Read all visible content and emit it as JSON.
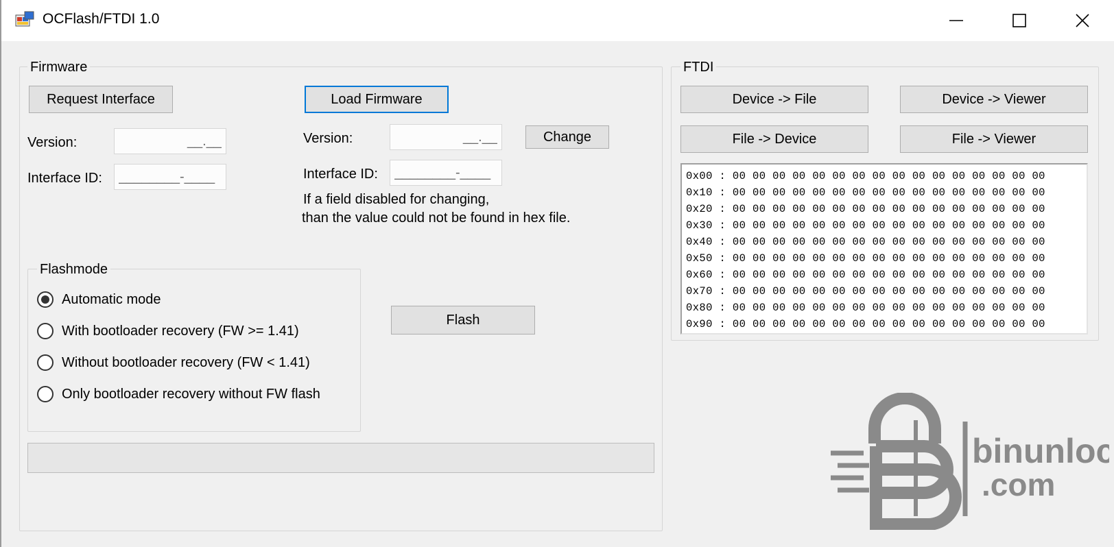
{
  "window": {
    "title": "OCFlash/FTDI 1.0"
  },
  "firmware": {
    "group_label": "Firmware",
    "request_interface_label": "Request Interface",
    "load_firmware_label": "Load Firmware",
    "version_label": "Version:",
    "interface_id_label": "Interface ID:",
    "version_value": "__.__",
    "interface_id_value": "________-____",
    "fw_version_label": "Version:",
    "fw_version_value": "__.__",
    "fw_interface_id_label": "Interface ID:",
    "fw_interface_id_value": "________-____",
    "change_label": "Change",
    "note_line1": "If a field disabled for changing,",
    "note_line2": "than the value could not be found in hex file."
  },
  "flashmode": {
    "group_label": "Flashmode",
    "options": [
      {
        "label": "Automatic mode",
        "checked": true
      },
      {
        "label": "With bootloader recovery (FW >= 1.41)",
        "checked": false
      },
      {
        "label": "Without bootloader recovery (FW < 1.41)",
        "checked": false
      },
      {
        "label": "Only bootloader recovery without FW flash",
        "checked": false
      }
    ]
  },
  "flash_button_label": "Flash",
  "progress": {
    "percent": 0
  },
  "ftdi": {
    "group_label": "FTDI",
    "device_to_file_label": "Device -> File",
    "device_to_viewer_label": "Device -> Viewer",
    "file_to_device_label": "File -> Device",
    "file_to_viewer_label": "File -> Viewer",
    "hex_rows": [
      "0x00 : 00 00 00 00 00 00 00 00 00 00 00 00 00 00 00 00",
      "0x10 : 00 00 00 00 00 00 00 00 00 00 00 00 00 00 00 00",
      "0x20 : 00 00 00 00 00 00 00 00 00 00 00 00 00 00 00 00",
      "0x30 : 00 00 00 00 00 00 00 00 00 00 00 00 00 00 00 00",
      "0x40 : 00 00 00 00 00 00 00 00 00 00 00 00 00 00 00 00",
      "0x50 : 00 00 00 00 00 00 00 00 00 00 00 00 00 00 00 00",
      "0x60 : 00 00 00 00 00 00 00 00 00 00 00 00 00 00 00 00",
      "0x70 : 00 00 00 00 00 00 00 00 00 00 00 00 00 00 00 00",
      "0x80 : 00 00 00 00 00 00 00 00 00 00 00 00 00 00 00 00",
      "0x90 : 00 00 00 00 00 00 00 00 00 00 00 00 00 00 00 00"
    ]
  },
  "watermark": {
    "brand_line1": "binunlock",
    "brand_line2": ".com"
  },
  "colors": {
    "accent": "#0078d7",
    "watermark": "#8a8a8a",
    "progress": "#06b025"
  },
  "icons": {
    "app": "app-icon",
    "minimize": "minimize-icon",
    "maximize": "maximize-icon",
    "close": "close-icon",
    "logo": "padlock-b-logo"
  }
}
